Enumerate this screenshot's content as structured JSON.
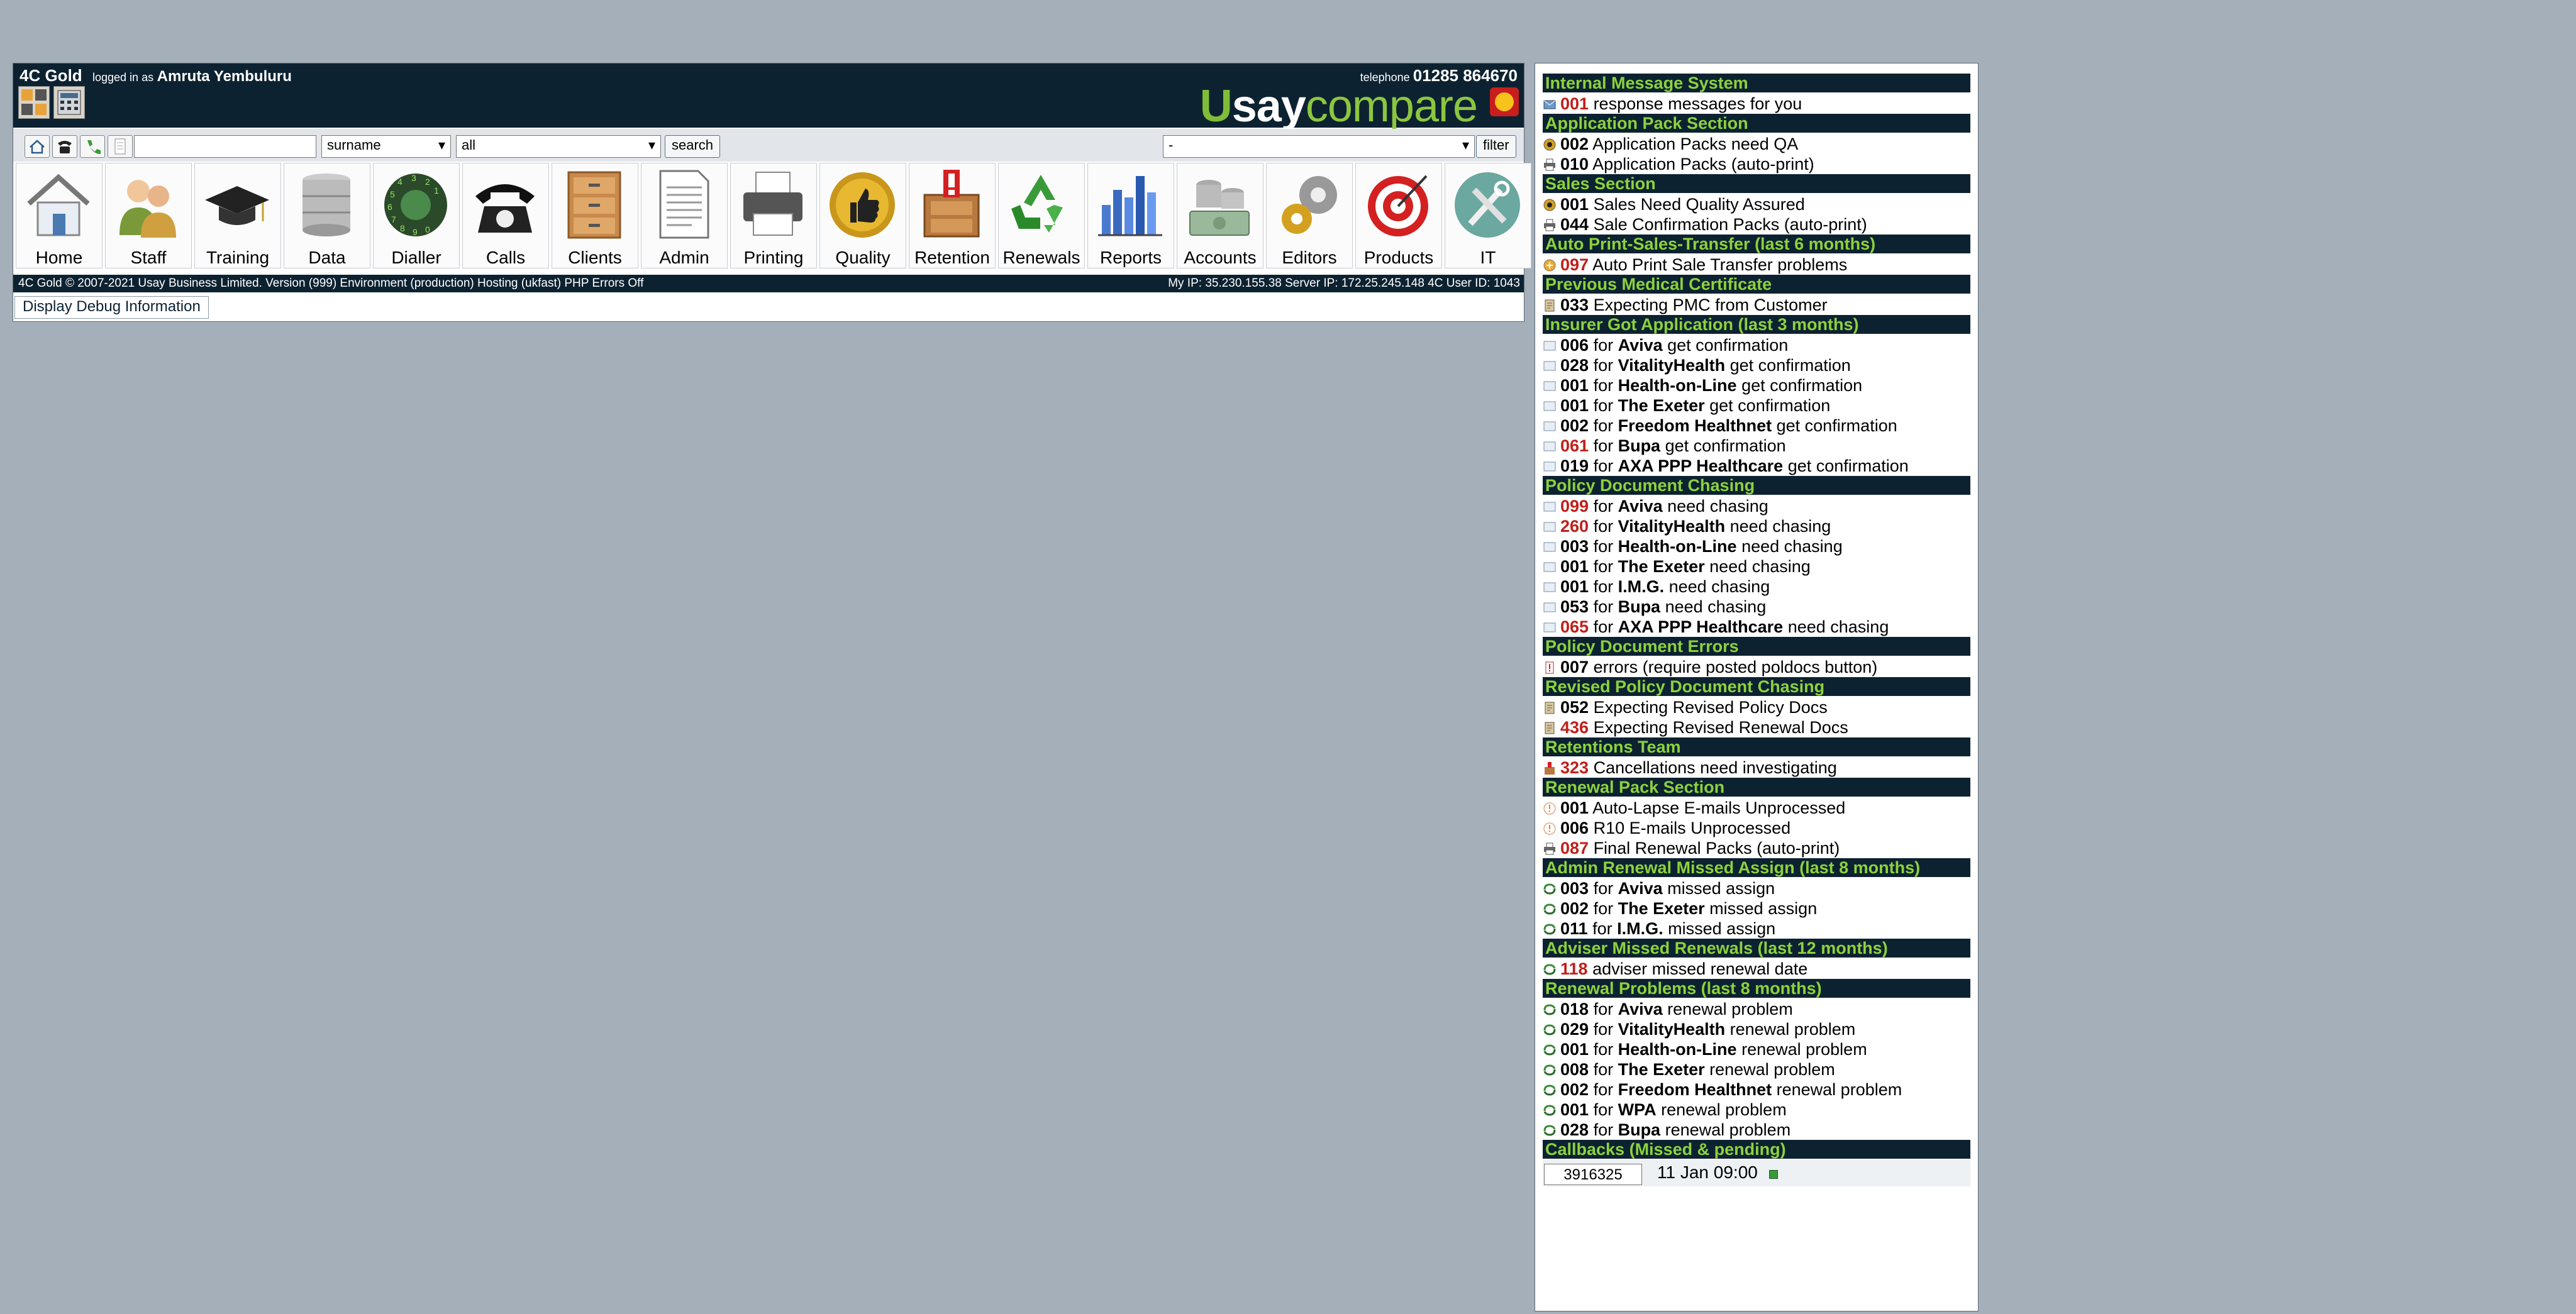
{
  "header": {
    "app_name": "4C Gold",
    "logged_in_label": "logged in as",
    "user_name": "Amruta Yembuluru",
    "telephone_label": "telephone",
    "telephone_number": "01285 864670",
    "logo": {
      "u": "U",
      "say": "say",
      "compare": "compare"
    }
  },
  "search": {
    "input_value": "",
    "field_select": "surname",
    "scope_select": "all",
    "search_button": "search",
    "filter_select": "-",
    "filter_button": "filter"
  },
  "modules": [
    {
      "label": "Home",
      "icon": "house-icon"
    },
    {
      "label": "Staff",
      "icon": "people-icon"
    },
    {
      "label": "Training",
      "icon": "graduation-cap-icon"
    },
    {
      "label": "Data",
      "icon": "database-icon"
    },
    {
      "label": "Dialler",
      "icon": "rotary-dial-icon"
    },
    {
      "label": "Calls",
      "icon": "telephone-icon"
    },
    {
      "label": "Clients",
      "icon": "filing-cabinet-icon"
    },
    {
      "label": "Admin",
      "icon": "document-icon"
    },
    {
      "label": "Printing",
      "icon": "printer-icon"
    },
    {
      "label": "Quality",
      "icon": "thumbs-up-icon"
    },
    {
      "label": "Retention",
      "icon": "alert-cabinet-icon"
    },
    {
      "label": "Renewals",
      "icon": "recycle-icon"
    },
    {
      "label": "Reports",
      "icon": "bar-chart-icon"
    },
    {
      "label": "Accounts",
      "icon": "money-icon"
    },
    {
      "label": "Editors",
      "icon": "gears-icon"
    },
    {
      "label": "Products",
      "icon": "target-icon"
    },
    {
      "label": "IT",
      "icon": "tools-icon"
    }
  ],
  "footer": {
    "left": "4C Gold © 2007-2021 Usay Business Limited. Version (999) Environment (production) Hosting (ukfast) PHP Errors Off",
    "right": "My IP: 35.230.155.38 Server IP: 172.25.245.148 4C User ID: 1043"
  },
  "debug_button": "Display Debug Information",
  "sidebar": {
    "sections": [
      {
        "title": "Internal Message System",
        "rows": [
          {
            "icon": "message-icon",
            "num": "001",
            "red": true,
            "parts": [
              {
                "t": " response messages for you"
              }
            ]
          }
        ]
      },
      {
        "title": "Application Pack Section",
        "rows": [
          {
            "icon": "qa-icon",
            "num": "002",
            "red": false,
            "parts": [
              {
                "t": " Application Packs need QA"
              }
            ]
          },
          {
            "icon": "print-icon",
            "num": "010",
            "red": false,
            "parts": [
              {
                "t": " Application Packs (auto-print)"
              }
            ]
          }
        ]
      },
      {
        "title": "Sales Section",
        "rows": [
          {
            "icon": "qa-icon",
            "num": "001",
            "red": false,
            "parts": [
              {
                "t": " Sales Need Quality Assured"
              }
            ]
          },
          {
            "icon": "print-icon",
            "num": "044",
            "red": false,
            "parts": [
              {
                "t": " Sale Confirmation Packs (auto-print)"
              }
            ]
          }
        ]
      },
      {
        "title": "Auto Print-Sales-Transfer (last 6 months)",
        "rows": [
          {
            "icon": "warning-icon",
            "num": "097",
            "red": true,
            "parts": [
              {
                "t": " Auto Print Sale Transfer problems"
              }
            ]
          }
        ]
      },
      {
        "title": "Previous Medical Certificate",
        "rows": [
          {
            "icon": "certificate-icon",
            "num": "033",
            "red": false,
            "parts": [
              {
                "t": " Expecting PMC from Customer"
              }
            ]
          }
        ]
      },
      {
        "title": "Insurer Got Application (last 3 months)",
        "rows": [
          {
            "icon": "doc-icon",
            "num": "006",
            "red": false,
            "parts": [
              {
                "t": " for "
              },
              {
                "t": "Aviva",
                "b": true
              },
              {
                "t": " get confirmation"
              }
            ]
          },
          {
            "icon": "doc-icon",
            "num": "028",
            "red": false,
            "parts": [
              {
                "t": " for "
              },
              {
                "t": "VitalityHealth",
                "b": true
              },
              {
                "t": " get confirmation"
              }
            ]
          },
          {
            "icon": "doc-icon",
            "num": "001",
            "red": false,
            "parts": [
              {
                "t": " for "
              },
              {
                "t": "Health-on-Line",
                "b": true
              },
              {
                "t": " get confirmation"
              }
            ]
          },
          {
            "icon": "doc-icon",
            "num": "001",
            "red": false,
            "parts": [
              {
                "t": " for "
              },
              {
                "t": "The Exeter",
                "b": true
              },
              {
                "t": " get confirmation"
              }
            ]
          },
          {
            "icon": "doc-icon",
            "num": "002",
            "red": false,
            "parts": [
              {
                "t": " for "
              },
              {
                "t": "Freedom Healthnet",
                "b": true
              },
              {
                "t": " get confirmation"
              }
            ]
          },
          {
            "icon": "doc-icon",
            "num": "061",
            "red": true,
            "parts": [
              {
                "t": " for "
              },
              {
                "t": "Bupa",
                "b": true
              },
              {
                "t": " get confirmation"
              }
            ]
          },
          {
            "icon": "doc-icon",
            "num": "019",
            "red": false,
            "parts": [
              {
                "t": " for "
              },
              {
                "t": "AXA PPP Healthcare",
                "b": true
              },
              {
                "t": " get confirmation"
              }
            ]
          }
        ]
      },
      {
        "title": "Policy Document Chasing",
        "rows": [
          {
            "icon": "doc-icon",
            "num": "099",
            "red": true,
            "parts": [
              {
                "t": " for "
              },
              {
                "t": "Aviva",
                "b": true
              },
              {
                "t": " need chasing"
              }
            ]
          },
          {
            "icon": "doc-icon",
            "num": "260",
            "red": true,
            "parts": [
              {
                "t": " for "
              },
              {
                "t": "VitalityHealth",
                "b": true
              },
              {
                "t": " need chasing"
              }
            ]
          },
          {
            "icon": "doc-icon",
            "num": "003",
            "red": false,
            "parts": [
              {
                "t": " for "
              },
              {
                "t": "Health-on-Line",
                "b": true
              },
              {
                "t": " need chasing"
              }
            ]
          },
          {
            "icon": "doc-icon",
            "num": "001",
            "red": false,
            "parts": [
              {
                "t": " for "
              },
              {
                "t": "The Exeter",
                "b": true
              },
              {
                "t": " need chasing"
              }
            ]
          },
          {
            "icon": "doc-icon",
            "num": "001",
            "red": false,
            "parts": [
              {
                "t": " for "
              },
              {
                "t": "I.M.G.",
                "b": true
              },
              {
                "t": " need chasing"
              }
            ]
          },
          {
            "icon": "doc-icon",
            "num": "053",
            "red": false,
            "parts": [
              {
                "t": " for "
              },
              {
                "t": "Bupa",
                "b": true
              },
              {
                "t": " need chasing"
              }
            ]
          },
          {
            "icon": "doc-icon",
            "num": "065",
            "red": true,
            "parts": [
              {
                "t": " for "
              },
              {
                "t": "AXA PPP Healthcare",
                "b": true
              },
              {
                "t": " need chasing"
              }
            ]
          }
        ]
      },
      {
        "title": "Policy Document Errors",
        "rows": [
          {
            "icon": "error-icon",
            "num": "007",
            "red": false,
            "parts": [
              {
                "t": " errors (require posted poldocs button)"
              }
            ]
          }
        ]
      },
      {
        "title": "Revised Policy Document Chasing",
        "rows": [
          {
            "icon": "certificate-icon",
            "num": "052",
            "red": false,
            "parts": [
              {
                "t": " Expecting Revised Policy Docs"
              }
            ]
          },
          {
            "icon": "certificate-icon",
            "num": "436",
            "red": true,
            "parts": [
              {
                "t": " Expecting Revised Renewal Docs"
              }
            ]
          }
        ]
      },
      {
        "title": "Retentions Team",
        "rows": [
          {
            "icon": "cabinet-alert-icon",
            "num": "323",
            "red": true,
            "parts": [
              {
                "t": " Cancellations need investigating"
              }
            ]
          }
        ]
      },
      {
        "title": "Renewal Pack Section",
        "rows": [
          {
            "icon": "email-alert-icon",
            "num": "001",
            "red": false,
            "parts": [
              {
                "t": " Auto-Lapse E-mails Unprocessed"
              }
            ]
          },
          {
            "icon": "email-alert-icon",
            "num": "006",
            "red": false,
            "parts": [
              {
                "t": " R10 E-mails Unprocessed"
              }
            ]
          },
          {
            "icon": "print-icon",
            "num": "087",
            "red": true,
            "parts": [
              {
                "t": " Final Renewal Packs (auto-print)"
              }
            ]
          }
        ]
      },
      {
        "title": "Admin Renewal Missed Assign (last 8 months)",
        "rows": [
          {
            "icon": "renew-icon",
            "num": "003",
            "red": false,
            "parts": [
              {
                "t": " for "
              },
              {
                "t": "Aviva",
                "b": true
              },
              {
                "t": " missed assign"
              }
            ]
          },
          {
            "icon": "renew-icon",
            "num": "002",
            "red": false,
            "parts": [
              {
                "t": " for "
              },
              {
                "t": "The Exeter",
                "b": true
              },
              {
                "t": " missed assign"
              }
            ]
          },
          {
            "icon": "renew-icon",
            "num": "011",
            "red": false,
            "parts": [
              {
                "t": " for "
              },
              {
                "t": "I.M.G.",
                "b": true
              },
              {
                "t": " missed assign"
              }
            ]
          }
        ]
      },
      {
        "title": "Adviser Missed Renewals (last 12 months)",
        "rows": [
          {
            "icon": "renew-icon",
            "num": "118",
            "red": true,
            "parts": [
              {
                "t": " adviser missed renewal date"
              }
            ]
          }
        ]
      },
      {
        "title": "Renewal Problems (last 8 months)",
        "rows": [
          {
            "icon": "renew-icon",
            "num": "018",
            "red": false,
            "parts": [
              {
                "t": " for "
              },
              {
                "t": "Aviva",
                "b": true
              },
              {
                "t": " renewal problem"
              }
            ]
          },
          {
            "icon": "renew-icon",
            "num": "029",
            "red": false,
            "parts": [
              {
                "t": " for "
              },
              {
                "t": "VitalityHealth",
                "b": true
              },
              {
                "t": " renewal problem"
              }
            ]
          },
          {
            "icon": "renew-icon",
            "num": "001",
            "red": false,
            "parts": [
              {
                "t": " for "
              },
              {
                "t": "Health-on-Line",
                "b": true
              },
              {
                "t": " renewal problem"
              }
            ]
          },
          {
            "icon": "renew-icon",
            "num": "008",
            "red": false,
            "parts": [
              {
                "t": " for "
              },
              {
                "t": "The Exeter",
                "b": true
              },
              {
                "t": " renewal problem"
              }
            ]
          },
          {
            "icon": "renew-icon",
            "num": "002",
            "red": false,
            "parts": [
              {
                "t": " for "
              },
              {
                "t": "Freedom Healthnet",
                "b": true
              },
              {
                "t": " renewal problem"
              }
            ]
          },
          {
            "icon": "renew-icon",
            "num": "001",
            "red": false,
            "parts": [
              {
                "t": " for "
              },
              {
                "t": "WPA",
                "b": true
              },
              {
                "t": " renewal problem"
              }
            ]
          },
          {
            "icon": "renew-icon",
            "num": "028",
            "red": false,
            "parts": [
              {
                "t": " for "
              },
              {
                "t": "Bupa",
                "b": true
              },
              {
                "t": " renewal problem"
              }
            ]
          }
        ]
      }
    ],
    "callbacks": {
      "title": "Callbacks (Missed & pending)",
      "id": "3916325",
      "datetime": "11 Jan 09:00"
    }
  },
  "colors": {
    "background": "#a4afb9",
    "header": "#0d2231",
    "section_text": "#8cd23c",
    "alert_number": "#c0201a"
  }
}
